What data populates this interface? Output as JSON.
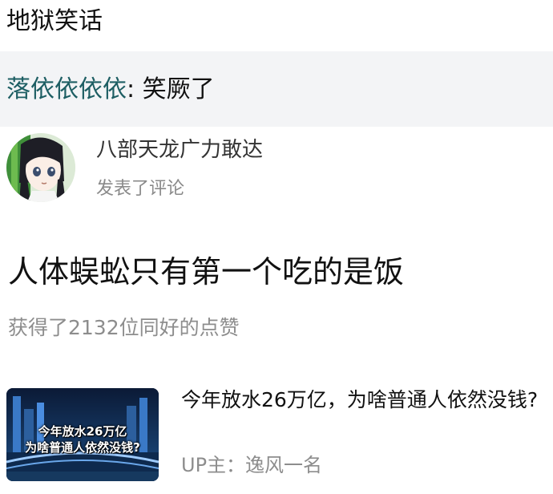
{
  "header": {
    "title": "地狱笑话"
  },
  "reply": {
    "author": "落依依依依",
    "separator": ":",
    "text": "笑厥了"
  },
  "comment": {
    "user_name": "八部天龙广力敢达",
    "action": "发表了评论",
    "avatar_icon": "anime-girl-avatar",
    "body": "人体蜈蚣只有第一个吃的是饭",
    "likes_text": "获得了2132位同好的点赞"
  },
  "video": {
    "thumbnail_caption_line1": "今年放水26万亿",
    "thumbnail_caption_line2": "为啥普通人依然没钱?",
    "title": "今年放水26万亿，为啥普通人依然没钱?",
    "up_label": "UP主：",
    "up_name": "逸风一名"
  },
  "colors": {
    "reply_author": "#1d5e63",
    "reply_strip_bg": "#f3f4f6",
    "muted_text": "#8d8d8d"
  }
}
